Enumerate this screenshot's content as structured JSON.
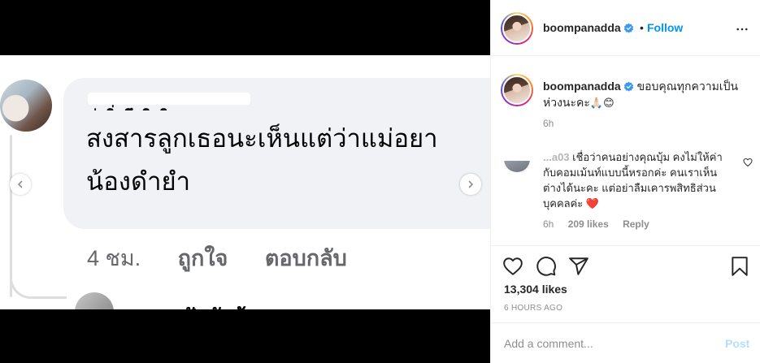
{
  "post": {
    "image": {
      "comment_author_hidden": "ร่าสิ่าศึงชิงทิ",
      "comment_line1": "สงสารลูกเธอนะเห็นแต่ว่าแม่อยา",
      "comment_line2": "น้องดำยำ",
      "comment_time": "4 ชม.",
      "comment_like": "ถูกใจ",
      "comment_reply": "ตอบกลับ",
      "next_reply_cut": "ศุณๆ   ฝัดงับว้ว   ๆ"
    }
  },
  "header": {
    "username": "boompanadda",
    "separator": "•",
    "follow_label": "Follow"
  },
  "caption": {
    "username": "boompanadda",
    "text": "ขอบคุณทุกความเป็นห่วงนะคะ",
    "emoji": "🙏🏻😊",
    "time": "6h"
  },
  "comment": {
    "username": "...a03",
    "text": "เชื่อว่าคนอย่างคุณบุ้ม คงไม่ให้ค่ากับคอมเม้นท์แบบนี้หรอกค่ะ คนเราเห็นต่างได้นะคะ แต่อย่าลืมเคารพสิทธิส่วนบุคคลค่ะ",
    "emoji": "❤️",
    "time": "6h",
    "likes": "209 likes",
    "reply_label": "Reply"
  },
  "actions": {
    "likes_count": "13,304 likes",
    "posted_ago": "6 HOURS AGO"
  },
  "add_comment": {
    "placeholder": "Add a comment...",
    "post_label": "Post"
  },
  "colors": {
    "accent": "#0095f6",
    "post_disabled": "#b2dffc",
    "muted": "#8e8e8e",
    "verified": "#3897f0",
    "heart": "#ed1c24"
  }
}
